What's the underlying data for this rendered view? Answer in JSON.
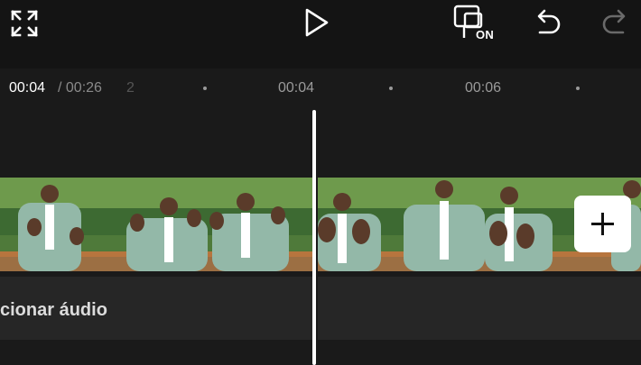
{
  "toolbar": {
    "fullscreen_icon": "fullscreen-icon",
    "play_icon": "play-icon",
    "display_toggle_icon": "display-toggle-icon",
    "display_toggle_state": "ON",
    "undo_icon": "undo-icon",
    "redo_icon": "redo-icon"
  },
  "timeline": {
    "current_time": "00:04",
    "total_time": "/ 00:26",
    "partial_tick": "2",
    "ticks": [
      "00:04",
      "00:06"
    ]
  },
  "tracks": {
    "audio_label": "cionar áudio",
    "add_clip_icon": "plus-icon"
  },
  "colors": {
    "background": "#141414",
    "track_background": "#262626",
    "playhead": "#ffffff"
  }
}
